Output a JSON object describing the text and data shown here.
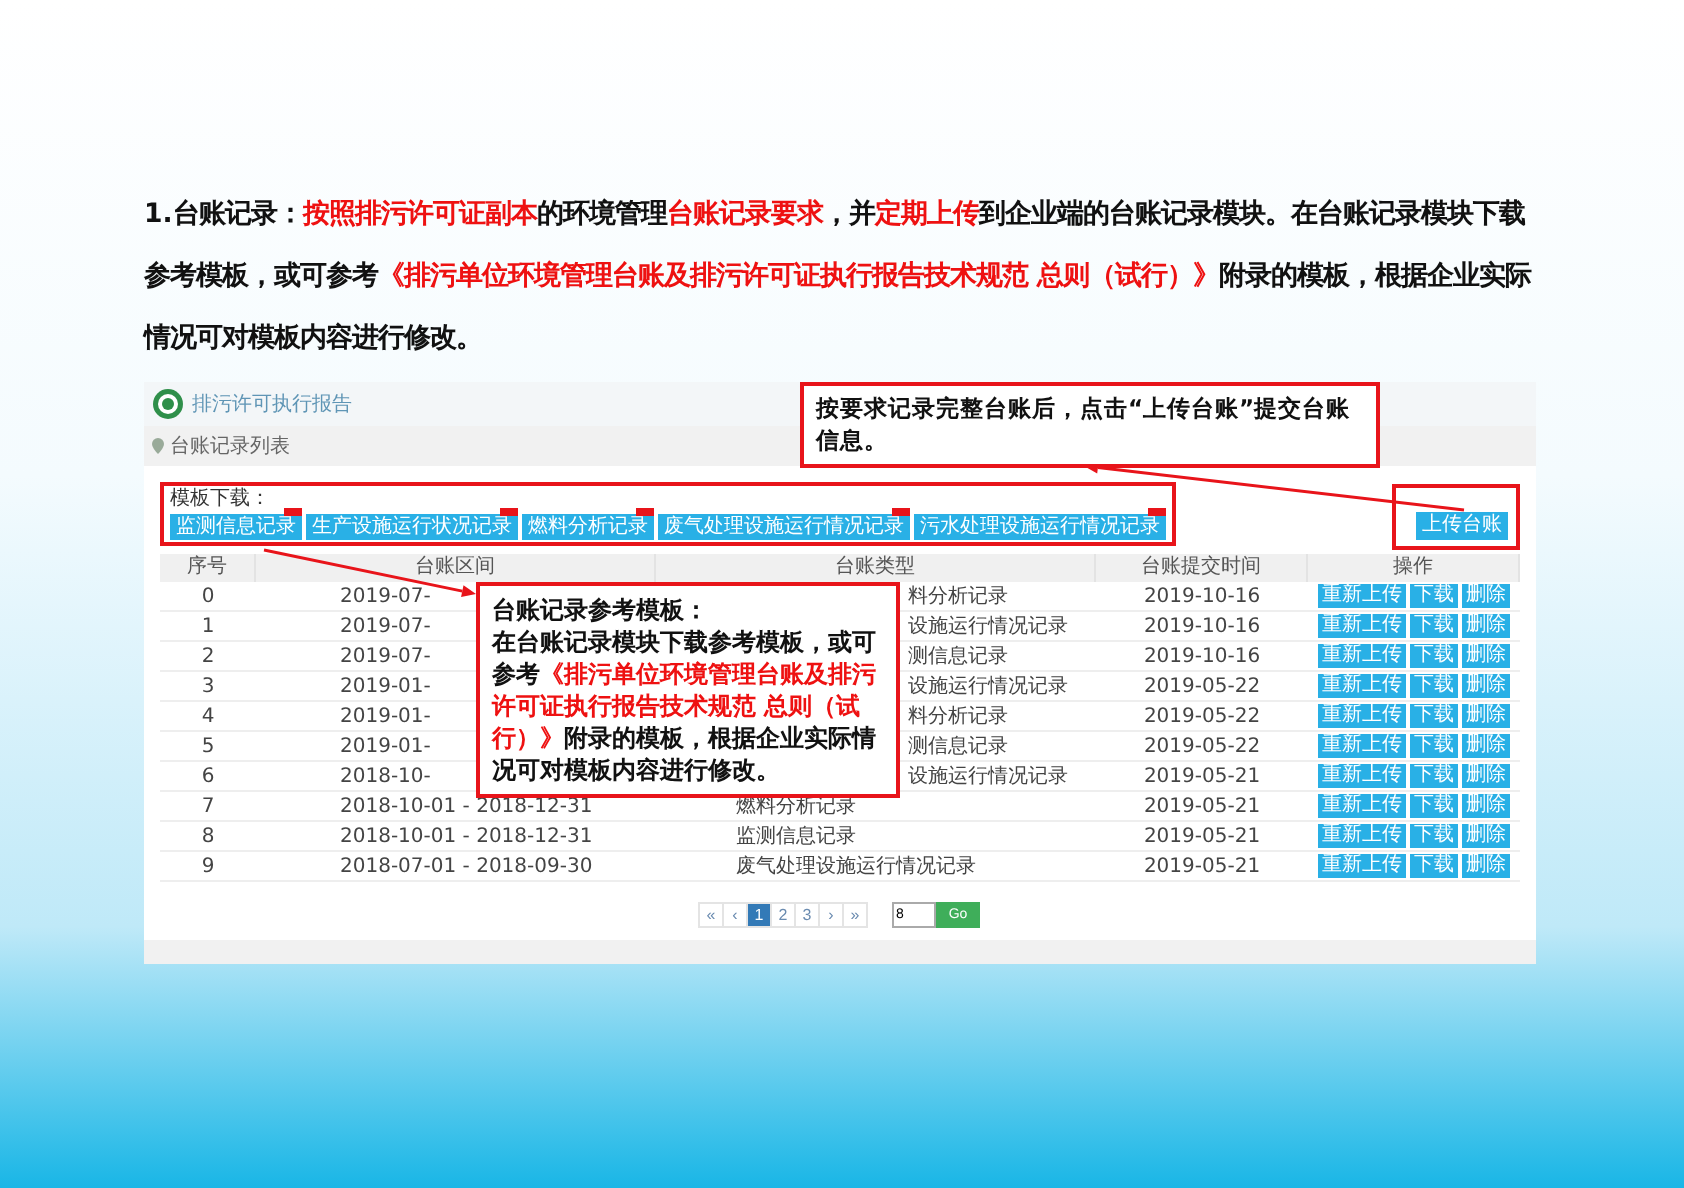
{
  "intro": [
    {
      "text": "1.台账记录：",
      "highlight": false
    },
    {
      "text": "按照排污许可证副本",
      "highlight": true
    },
    {
      "text": "的环境管理",
      "highlight": false
    },
    {
      "text": "台账记录要求",
      "highlight": true
    },
    {
      "text": "，并",
      "highlight": false
    },
    {
      "text": "定期上传",
      "highlight": true
    },
    {
      "text": "到企业端的台账记录模块。在台账记录模块下载参考模板，或可参考",
      "highlight": false
    },
    {
      "text": "《排污单位环境管理台账及排污许可证执行报告技术规范  总则（试行）》",
      "highlight": true
    },
    {
      "text": "附录的模板，根据企业实际情况可对模板内容进行修改。",
      "highlight": false
    }
  ],
  "app": {
    "title": "排污许可执行报告",
    "breadcrumb": "台账记录列表",
    "download_label": "模板下载：",
    "upload_button": "上传台账",
    "templates": [
      "监测信息记录",
      "生产设施运行状况记录",
      "燃料分析记录",
      "废气处理设施运行情况记录",
      "污水处理设施运行情况记录"
    ],
    "table": {
      "columns": [
        "序号",
        "台账区间",
        "台账类型",
        "台账提交时间",
        "操作"
      ],
      "rows": [
        {
          "index": "0",
          "interval": "2019-07-",
          "type": "料分析记录",
          "time": "2019-10-16"
        },
        {
          "index": "1",
          "interval": "2019-07-",
          "type": "设施运行情况记录",
          "time": "2019-10-16"
        },
        {
          "index": "2",
          "interval": "2019-07-",
          "type": "测信息记录",
          "time": "2019-10-16"
        },
        {
          "index": "3",
          "interval": "2019-01-",
          "type": "设施运行情况记录",
          "time": "2019-05-22"
        },
        {
          "index": "4",
          "interval": "2019-01-",
          "type": "料分析记录",
          "time": "2019-05-22"
        },
        {
          "index": "5",
          "interval": "2019-01-",
          "type": "测信息记录",
          "time": "2019-05-22"
        },
        {
          "index": "6",
          "interval": "2018-10-",
          "type": "设施运行情况记录",
          "time": "2019-05-21"
        },
        {
          "index": "7",
          "interval": "2018-10-01 - 2018-12-31",
          "type": "燃料分析记录",
          "time": "2019-05-21"
        },
        {
          "index": "8",
          "interval": "2018-10-01 - 2018-12-31",
          "type": "监测信息记录",
          "time": "2019-05-21"
        },
        {
          "index": "9",
          "interval": "2018-07-01 - 2018-09-30",
          "type": "废气处理设施运行情况记录",
          "time": "2019-05-21"
        }
      ],
      "actions": [
        [
          "重新上传",
          "下载",
          "删除"
        ],
        [
          "重新上传",
          "下载",
          "删除"
        ],
        [
          "重新上传",
          "下载",
          "删除"
        ],
        [
          "重新上传",
          "下载",
          "删除"
        ],
        [
          "重新上传",
          "下载",
          "删除"
        ],
        [
          "重新上传",
          "下载",
          "删除"
        ],
        [
          "重新上传",
          "下载",
          "删除"
        ],
        [
          "重新上传",
          "下载",
          "删除"
        ],
        [
          "重新上传",
          "下载",
          "删除"
        ],
        [
          "重新上传",
          "下载",
          "删除"
        ]
      ]
    },
    "pagination": {
      "pages": [
        {
          "label": "«",
          "selected": false
        },
        {
          "label": "‹",
          "selected": false
        },
        {
          "label": "1",
          "selected": true
        },
        {
          "label": "2",
          "selected": false
        },
        {
          "label": "3",
          "selected": false
        },
        {
          "label": "›",
          "selected": false
        },
        {
          "label": "»",
          "selected": false
        }
      ],
      "page_input": "8",
      "go": "Go"
    }
  },
  "callout_upload": "按要求记录完整台账后，点击“上传台账”提交台账信息。",
  "callout_template": {
    "title": "台账记录参考模板：",
    "body": [
      {
        "text": "在台账记录模块下载参考模板，或可参考",
        "highlight": false
      },
      {
        "text": "《排污单位环境管理台账及排污许可证执行报告技术规范  总则（试行）》",
        "highlight": true
      },
      {
        "text": "附录的模板，根据企业实际情况可对模板内容进行修改。",
        "highlight": false
      }
    ]
  }
}
